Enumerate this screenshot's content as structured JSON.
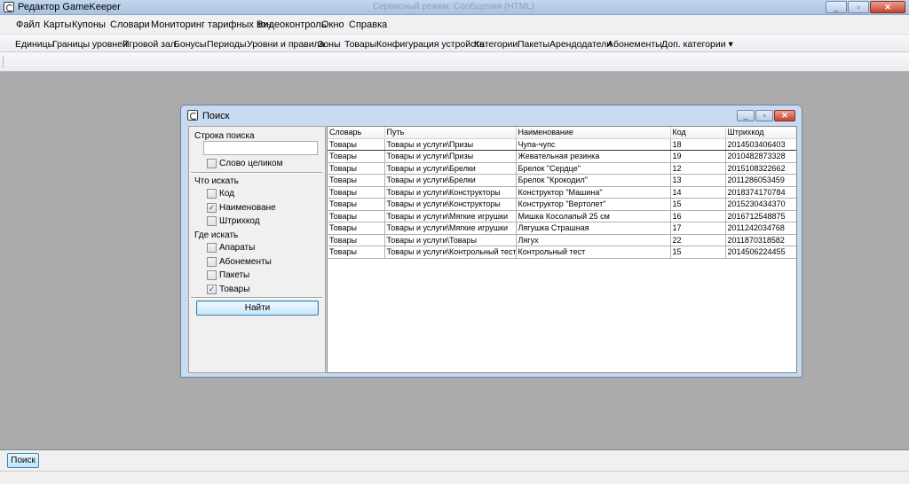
{
  "window": {
    "title": "Редактор GameKeeper",
    "faded_title": "Сервисный режим: Сообщения (HTML)"
  },
  "menu": [
    "Файл",
    "Карты",
    "Купоны",
    "Словари",
    "Мониторинг тарифных зон",
    "Видеоконтроль",
    "Окно",
    "Справка"
  ],
  "toolbar": [
    "Единицы",
    "Границы уровней",
    "Игровой зал",
    "Бонусы",
    "Периоды",
    "Уровни и правила",
    "Зоны",
    "Товары",
    "Конфигурация устройств",
    "Категории",
    "Пакеты",
    "Арендодатели",
    "Абонементы",
    "Доп. категории ▾"
  ],
  "dialog": {
    "title": "Поиск",
    "search_label": "Строка поиска",
    "search_value": "",
    "whole_word": {
      "label": "Слово целиком",
      "checked": false
    },
    "what_label": "Что искать",
    "what": [
      {
        "label": "Код",
        "checked": false
      },
      {
        "label": "Наименоване",
        "checked": true
      },
      {
        "label": "Штрихкод",
        "checked": false
      }
    ],
    "where_label": "Где искать",
    "where": [
      {
        "label": "Апараты",
        "checked": false
      },
      {
        "label": "Абонементы",
        "checked": false
      },
      {
        "label": "Пакеты",
        "checked": false
      },
      {
        "label": "Товары",
        "checked": true
      }
    ],
    "find_button": "Найти",
    "columns": [
      "Словарь",
      "Путь",
      "Наименование",
      "Код",
      "Штрихкод"
    ],
    "rows": [
      [
        "Товары",
        "Товары и услуги\\Призы",
        "Чупа-чупс",
        "18",
        "2014503406403"
      ],
      [
        "Товары",
        "Товары и услуги\\Призы",
        "Жевательная резинка",
        "19",
        "2010482873328"
      ],
      [
        "Товары",
        "Товары и услуги\\Брелки",
        "Брелок \"Сердце\"",
        "12",
        "2015108322662"
      ],
      [
        "Товары",
        "Товары и услуги\\Брелки",
        "Брелок \"Крокодил\"",
        "13",
        "2011286053459"
      ],
      [
        "Товары",
        "Товары и услуги\\Конструкторы",
        "Конструктор \"Машина\"",
        "14",
        "2018374170784"
      ],
      [
        "Товары",
        "Товары и услуги\\Конструкторы",
        "Конструктор \"Вертолет\"",
        "15",
        "2015230434370"
      ],
      [
        "Товары",
        "Товары и услуги\\Мягкие игрушки",
        "Мишка Косолапый 25 см",
        "16",
        "2016712548875"
      ],
      [
        "Товары",
        "Товары и услуги\\Мягкие игрушки",
        "Лягушка Страшная",
        "17",
        "2011242034768"
      ],
      [
        "Товары",
        "Товары и услуги\\Товары",
        "Лягух",
        "22",
        "2011870318582"
      ],
      [
        "Товары",
        "Товары и услуги\\Контрольный тест",
        "Контрольный тест",
        "15",
        "2014506224455"
      ]
    ]
  },
  "taskbar": {
    "item": "Поиск"
  }
}
